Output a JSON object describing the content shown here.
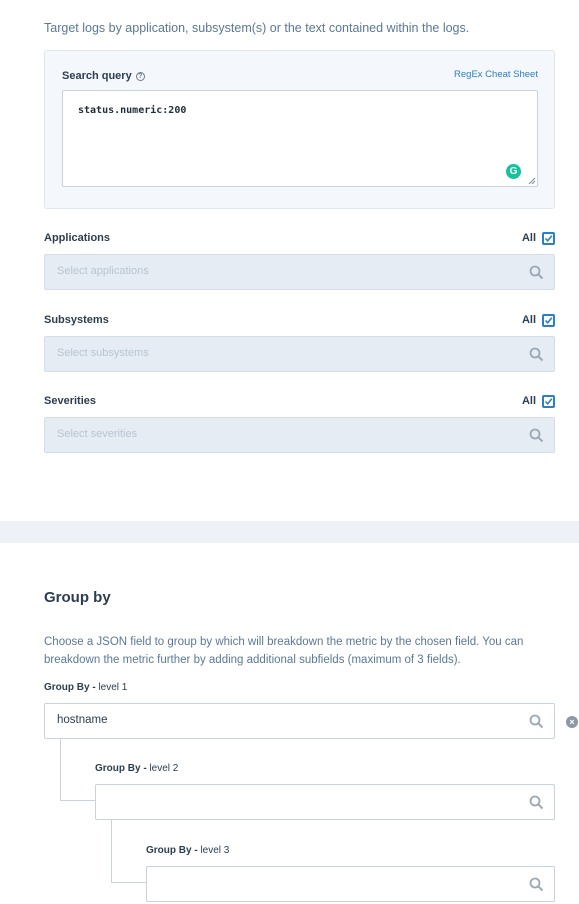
{
  "intro_text": "Target logs by application, subsystem(s) or the text contained within the logs.",
  "search_query": {
    "label": "Search query",
    "help_icon": "question-circle-icon",
    "cheat_sheet_link": "RegEx Cheat Sheet",
    "value": "status.numeric:200",
    "grammarly_glyph": "G"
  },
  "filters": [
    {
      "label": "Applications",
      "all_label": "All",
      "all_checked": true,
      "placeholder": "Select applications"
    },
    {
      "label": "Subsystems",
      "all_label": "All",
      "all_checked": true,
      "placeholder": "Select subsystems"
    },
    {
      "label": "Severities",
      "all_label": "All",
      "all_checked": true,
      "placeholder": "Select severities"
    }
  ],
  "group_by": {
    "title": "Group by",
    "description": "Choose a JSON field to group by which will breakdown the metric by the chosen field. You can breakdown the metric further by adding additional subfields (maximum of 3 fields).",
    "levels": [
      {
        "label_bold": "Group By -",
        "label_suffix": " level 1",
        "value": "hostname"
      },
      {
        "label_bold": "Group By -",
        "label_suffix": " level 2",
        "value": ""
      },
      {
        "label_bold": "Group By -",
        "label_suffix": " level 3",
        "value": ""
      }
    ],
    "remove_glyph": "×"
  },
  "colors": {
    "accent": "#2a7fc9",
    "grammarly": "#15c39a",
    "input_disabled_bg": "#e6ecf3",
    "section_divider": "#eef2f7"
  }
}
